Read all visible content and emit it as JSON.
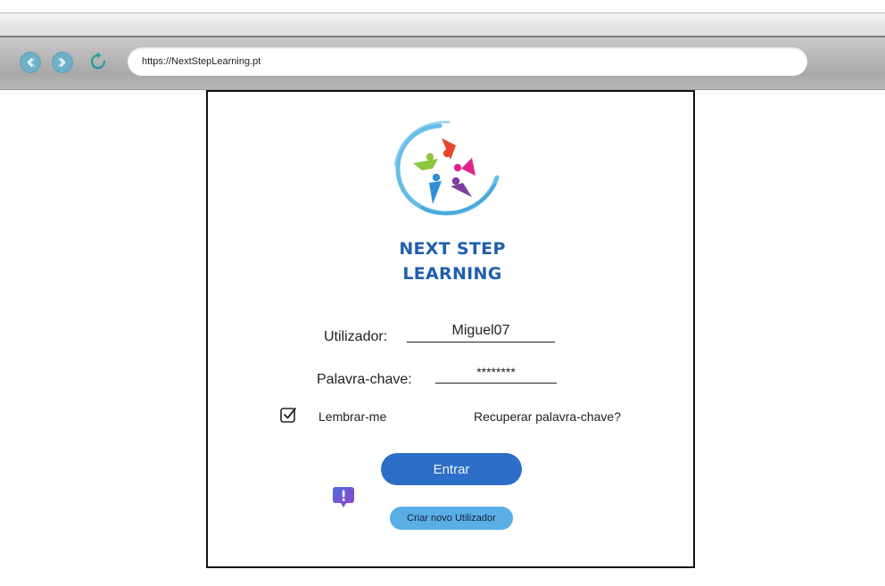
{
  "browser": {
    "url": "https://NextStepLearning.pt",
    "colors": {
      "nav_button": "#6fb0c9",
      "reload_icon": "#2aa39a"
    },
    "icons": {
      "back": "chevron-left-icon",
      "forward": "chevron-right-icon",
      "reload": "reload-icon"
    }
  },
  "login": {
    "brand_line1": "NEXT STEP",
    "brand_line2": "LEARNING",
    "username_label": "Utilizador:",
    "username_value": "Miguel07",
    "password_label": "Palavra-chave:",
    "password_value": "********",
    "remember_label": "Lembrar-me",
    "remember_checked": true,
    "recover_link": "Recuperar palavra-chave?",
    "submit_label": "Entrar",
    "create_user_label": "Criar novo Utilizador",
    "colors": {
      "brand": "#1f5fae",
      "submit_button": "#2c6ec8",
      "create_button": "#5aaee6",
      "help_icon": "#6a3fd1"
    },
    "icons": {
      "logo": "next-step-learning-logo",
      "help": "help-alert-icon",
      "checkbox": "checkbox-checked-icon"
    }
  }
}
